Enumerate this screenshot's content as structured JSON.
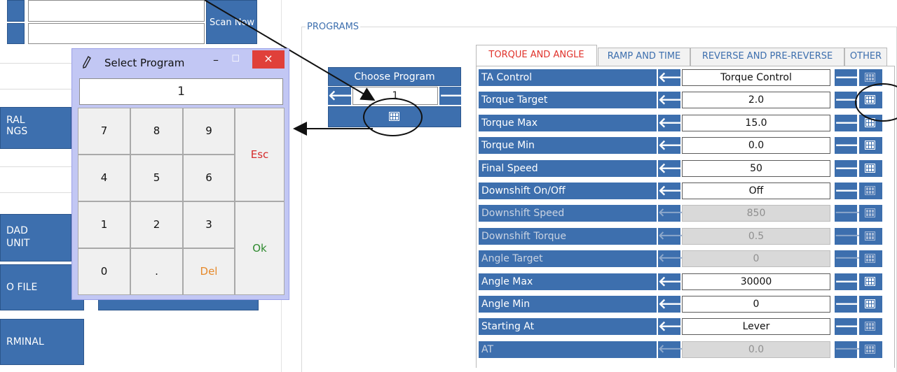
{
  "left": {
    "scan_button": "Scan Now",
    "general_settings": [
      "RAL",
      "NGS"
    ],
    "load_unit": [
      "DAD",
      "UNIT"
    ],
    "to_file": "O FILE",
    "terminal": "RMINAL"
  },
  "programs": {
    "group_label": "PROGRAMS",
    "choose_program_label": "Choose Program",
    "program_number": "1",
    "tabs": [
      "TORQUE AND ANGLE",
      "RAMP AND TIME",
      "REVERSE AND PRE-REVERSE",
      "OTHER"
    ],
    "params": [
      {
        "label": "TA Control",
        "value": "Torque Control"
      },
      {
        "label": "Torque Target",
        "value": "2.0"
      },
      {
        "label": "Torque Max",
        "value": "15.0"
      },
      {
        "label": "Torque Min",
        "value": "0.0"
      },
      {
        "label": "Final Speed",
        "value": "50"
      },
      {
        "label": "Downshift On/Off",
        "value": "Off"
      },
      {
        "label": "Downshift Speed",
        "value": "850"
      },
      {
        "label": "Downshift Torque",
        "value": "0.5"
      },
      {
        "label": "Angle Target",
        "value": "0"
      },
      {
        "label": "Angle Max",
        "value": "30000"
      },
      {
        "label": "Angle Min",
        "value": "0"
      },
      {
        "label": "Starting At",
        "value": "Lever"
      },
      {
        "label": "AT",
        "value": "0.0"
      }
    ]
  },
  "dialog": {
    "title": "Select Program",
    "display_value": "1",
    "close": "×",
    "minimize": "–",
    "maximize": "☐",
    "keys": {
      "k7": "7",
      "k8": "8",
      "k9": "9",
      "k4": "4",
      "k5": "5",
      "k6": "6",
      "k1": "1",
      "k2": "2",
      "k3": "3",
      "k0": "0",
      "dot": ".",
      "del": "Del",
      "esc": "Esc",
      "ok": "Ok"
    },
    "key_colors": {
      "esc": "#d42a2a",
      "ok": "#2f8a2f",
      "del": "#e6892a"
    }
  },
  "icons": {
    "arrow_left": "🡐",
    "arrow_right": "🡒",
    "keyboard": "keyboard-icon",
    "pencil": "pencil-icon"
  }
}
